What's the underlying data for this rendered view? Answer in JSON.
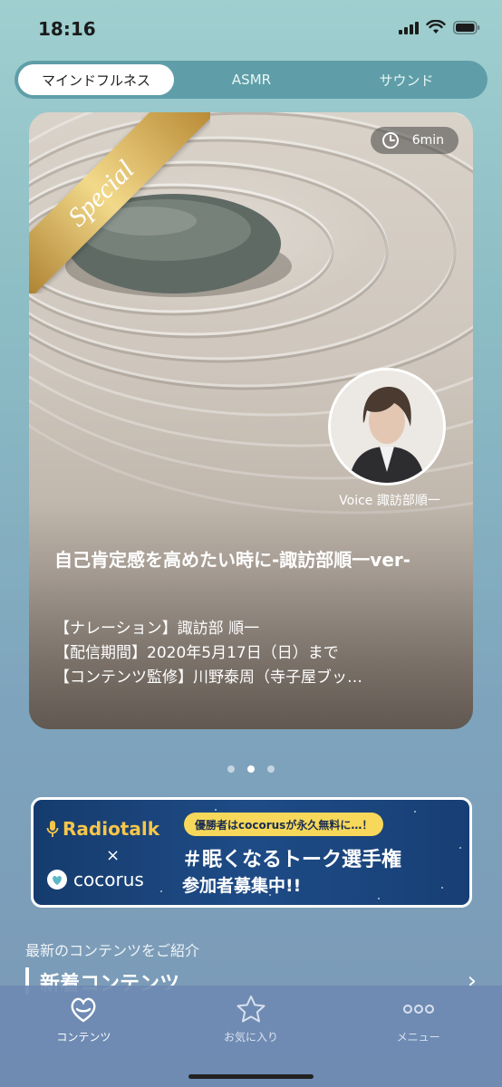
{
  "status_bar": {
    "time": "18:16"
  },
  "tabs": [
    {
      "label": "マインドフルネス",
      "active": true
    },
    {
      "label": "ASMR",
      "active": false
    },
    {
      "label": "サウンド",
      "active": false
    }
  ],
  "featured": {
    "ribbon": "Special",
    "duration": "6min",
    "voice_label": "Voice 諏訪部順一",
    "title": "自己肯定感を高めたい時に-諏訪部順一ver-",
    "details": [
      "【ナレーション】諏訪部 順一",
      "【配信期間】2020年5月17日（日）まで",
      "【コンテンツ監修】川野泰周（寺子屋ブッ…"
    ]
  },
  "carousel": {
    "page_count": 3,
    "current_index": 1
  },
  "banner": {
    "logo_left": "Radiotalk",
    "cross": "×",
    "logo_right": "cocorus",
    "pill": "優勝者はcocorusが永久無料に…！",
    "headline1": "＃眠くなるトーク選手権",
    "headline2": "参加者募集中!!"
  },
  "section": {
    "caption": "最新のコンテンツをご紹介",
    "title": "新着コンテンツ",
    "chevron": "›"
  },
  "tabbar": [
    {
      "label": "コンテンツ",
      "icon": "heart-drop-icon",
      "active": true
    },
    {
      "label": "お気に入り",
      "icon": "star-icon",
      "active": false
    },
    {
      "label": "メニュー",
      "icon": "more-dots-icon",
      "active": false
    }
  ],
  "colors": {
    "ribbon_gold": "#d9b45a",
    "banner_navy": "#1e4b86",
    "banner_pill": "#f7d85a",
    "radiotalk_yellow": "#f5c64a"
  }
}
